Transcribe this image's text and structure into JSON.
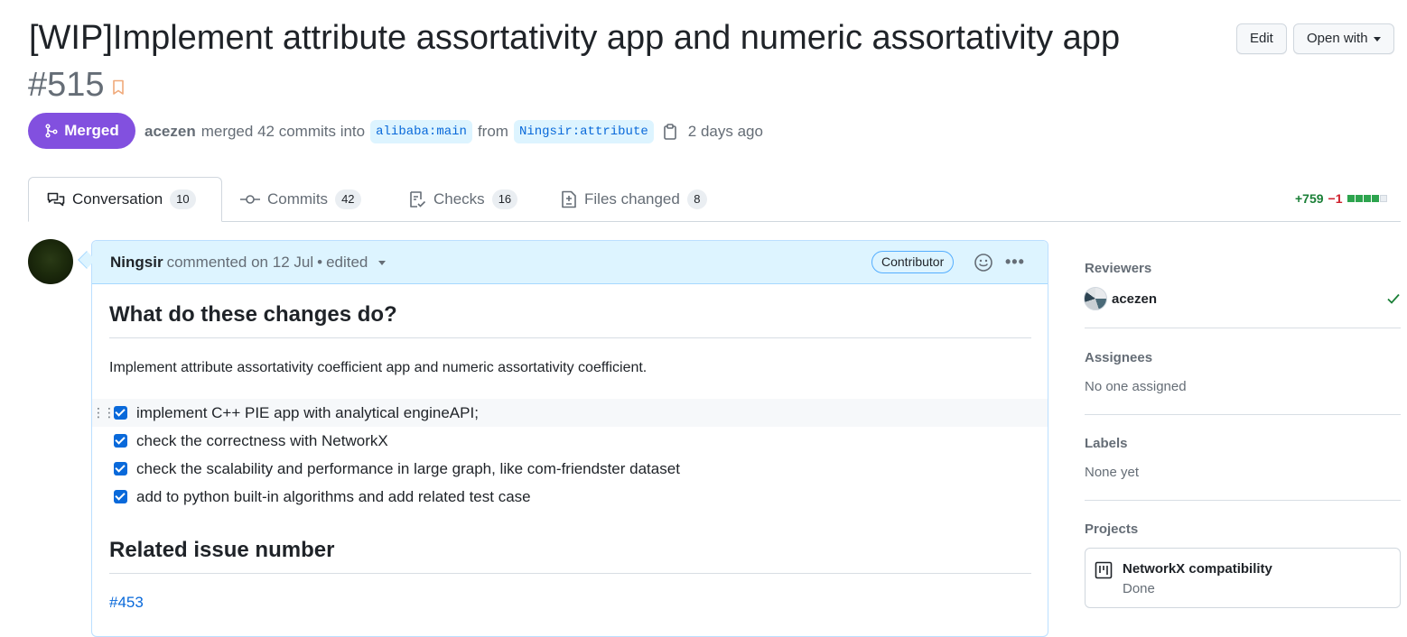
{
  "header": {
    "title": "[WIP]Implement attribute assortativity app and numeric assortativity app",
    "number": "#515",
    "edit_label": "Edit",
    "open_with_label": "Open with",
    "state_label": "Merged",
    "author": "acezen",
    "merged_text": "merged 42 commits into",
    "base_branch": "alibaba:main",
    "from_text": "from",
    "head_branch": "Ningsir:attribute",
    "time_ago": "2 days ago"
  },
  "tabs": [
    {
      "label": "Conversation",
      "count": "10",
      "icon": "comment-discussion-icon"
    },
    {
      "label": "Commits",
      "count": "42",
      "icon": "git-commit-icon"
    },
    {
      "label": "Checks",
      "count": "16",
      "icon": "checklist-icon"
    },
    {
      "label": "Files changed",
      "count": "8",
      "icon": "file-diff-icon"
    }
  ],
  "diffstat": {
    "additions": "+759",
    "deletions": "−1",
    "colors": {
      "add": "#2da44e",
      "empty": "#d0d7de"
    }
  },
  "comment": {
    "author": "Ningsir",
    "meta": "commented on 12 Jul",
    "separator": "•",
    "edited": "edited",
    "badge": "Contributor",
    "heading_1": "What do these changes do?",
    "description": "Implement attribute assortativity coefficient app and numeric assortativity coefficient.",
    "tasks": [
      "implement C++ PIE app with analytical engineAPI;",
      "check the correctness with NetworkX",
      "check the scalability and performance in large graph, like com-friendster dataset",
      "add to python built-in algorithms and add related test case"
    ],
    "heading_2": "Related issue number",
    "issue_link": "#453"
  },
  "sidebar": {
    "reviewers_title": "Reviewers",
    "reviewer_name": "acezen",
    "assignees_title": "Assignees",
    "assignees_value": "No one assigned",
    "labels_title": "Labels",
    "labels_value": "None yet",
    "projects_title": "Projects",
    "project_name": "NetworkX compatibility",
    "project_status": "Done"
  },
  "colors": {
    "merged": "#8250df",
    "link": "#0969da",
    "header_bg": "#ddf4ff"
  }
}
